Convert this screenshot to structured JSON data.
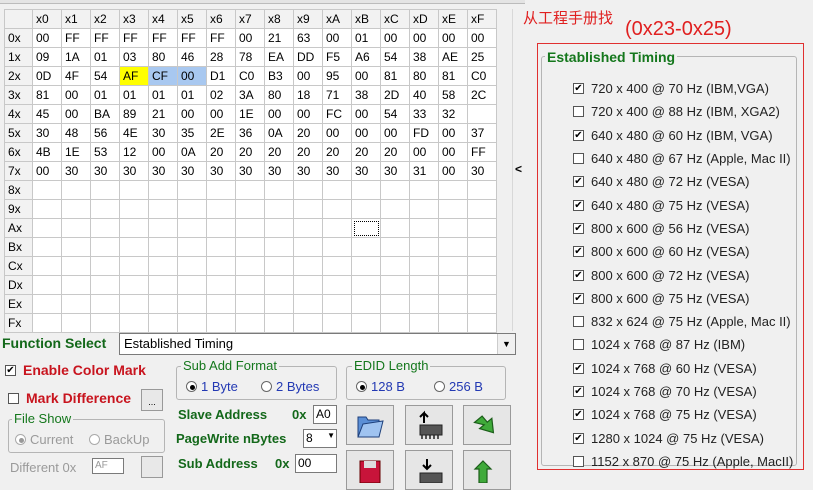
{
  "grid": {
    "col_headers": [
      "x0",
      "x1",
      "x2",
      "x3",
      "x4",
      "x5",
      "x6",
      "x7",
      "x8",
      "x9",
      "xA",
      "xB",
      "xC",
      "xD",
      "xE",
      "xF"
    ],
    "rows": [
      {
        "label": "0x",
        "cells": [
          "00",
          "FF",
          "FF",
          "FF",
          "FF",
          "FF",
          "FF",
          "00",
          "21",
          "63",
          "00",
          "01",
          "00",
          "00",
          "00",
          "00"
        ]
      },
      {
        "label": "1x",
        "cells": [
          "09",
          "1A",
          "01",
          "03",
          "80",
          "46",
          "28",
          "78",
          "EA",
          "DD",
          "F5",
          "A6",
          "54",
          "38",
          "AE",
          "25"
        ]
      },
      {
        "label": "2x",
        "cells": [
          "0D",
          "4F",
          "54",
          "AF",
          "CF",
          "00",
          "D1",
          "C0",
          "B3",
          "00",
          "95",
          "00",
          "81",
          "80",
          "81",
          "C0"
        ]
      },
      {
        "label": "3x",
        "cells": [
          "81",
          "00",
          "01",
          "01",
          "01",
          "01",
          "02",
          "3A",
          "80",
          "18",
          "71",
          "38",
          "2D",
          "40",
          "58",
          "2C"
        ]
      },
      {
        "label": "4x",
        "cells": [
          "45",
          "00",
          "BA",
          "89",
          "21",
          "00",
          "00",
          "1E",
          "00",
          "00",
          "FC",
          "00",
          "54",
          "33",
          "32",
          ""
        ]
      },
      {
        "label": "5x",
        "cells": [
          "30",
          "48",
          "56",
          "4E",
          "30",
          "35",
          "2E",
          "36",
          "0A",
          "20",
          "00",
          "00",
          "00",
          "FD",
          "00",
          "37"
        ]
      },
      {
        "label": "6x",
        "cells": [
          "4B",
          "1E",
          "53",
          "12",
          "00",
          "0A",
          "20",
          "20",
          "20",
          "20",
          "20",
          "20",
          "20",
          "00",
          "00",
          "FF"
        ]
      },
      {
        "label": "7x",
        "cells": [
          "00",
          "30",
          "30",
          "30",
          "30",
          "30",
          "30",
          "30",
          "30",
          "30",
          "30",
          "30",
          "30",
          "31",
          "00",
          "30"
        ]
      },
      {
        "label": "8x",
        "cells": [
          "",
          "",
          "",
          "",
          "",
          "",
          "",
          "",
          "",
          "",
          "",
          "",
          "",
          "",
          "",
          ""
        ]
      },
      {
        "label": "9x",
        "cells": [
          "",
          "",
          "",
          "",
          "",
          "",
          "",
          "",
          "",
          "",
          "",
          "",
          "",
          "",
          "",
          ""
        ]
      },
      {
        "label": "Ax",
        "cells": [
          "",
          "",
          "",
          "",
          "",
          "",
          "",
          "",
          "",
          "",
          "",
          "",
          "",
          "",
          "",
          ""
        ]
      },
      {
        "label": "Bx",
        "cells": [
          "",
          "",
          "",
          "",
          "",
          "",
          "",
          "",
          "",
          "",
          "",
          "",
          "",
          "",
          "",
          ""
        ]
      },
      {
        "label": "Cx",
        "cells": [
          "",
          "",
          "",
          "",
          "",
          "",
          "",
          "",
          "",
          "",
          "",
          "",
          "",
          "",
          "",
          ""
        ]
      },
      {
        "label": "Dx",
        "cells": [
          "",
          "",
          "",
          "",
          "",
          "",
          "",
          "",
          "",
          "",
          "",
          "",
          "",
          "",
          "",
          ""
        ]
      },
      {
        "label": "Ex",
        "cells": [
          "",
          "",
          "",
          "",
          "",
          "",
          "",
          "",
          "",
          "",
          "",
          "",
          "",
          "",
          "",
          ""
        ]
      },
      {
        "label": "Fx",
        "cells": [
          "",
          "",
          "",
          "",
          "",
          "",
          "",
          "",
          "",
          "",
          "",
          "",
          "",
          "",
          "",
          ""
        ]
      }
    ],
    "highlight_colors": {
      "yellow": "#ffff00",
      "blue": "#a8c8f0"
    }
  },
  "scroll_arrow": "<",
  "annotation": {
    "chinese_note": "从工程手册找",
    "range_note": "(0x23-0x25)",
    "color": "#e02020"
  },
  "established_timing": {
    "title": "Established Timing",
    "items": [
      {
        "label": "720 x 400 @ 70 Hz  (IBM,VGA)",
        "checked": true
      },
      {
        "label": "720 x 400 @ 88 Hz  (IBM, XGA2)",
        "checked": false
      },
      {
        "label": "640 x 480 @ 60 Hz  (IBM, VGA)",
        "checked": true
      },
      {
        "label": "640 x 480 @ 67 Hz  (Apple, Mac II)",
        "checked": false
      },
      {
        "label": "640 x 480 @ 72 Hz  (VESA)",
        "checked": true
      },
      {
        "label": "640 x 480 @ 75 Hz  (VESA)",
        "checked": true
      },
      {
        "label": "800 x 600 @ 56 Hz  (VESA)",
        "checked": true
      },
      {
        "label": "800 x 600 @ 60 Hz  (VESA)",
        "checked": true
      },
      {
        "label": "800 x 600 @ 72 Hz  (VESA)",
        "checked": true
      },
      {
        "label": "800 x 600 @ 75 Hz  (VESA)",
        "checked": true
      },
      {
        "label": "832 x 624 @ 75 Hz  (Apple, Mac II)",
        "checked": false
      },
      {
        "label": "1024 x 768 @ 87 Hz (IBM)",
        "checked": false
      },
      {
        "label": "1024 x 768 @ 60 Hz  (VESA)",
        "checked": true
      },
      {
        "label": "1024 x 768 @ 70 Hz  (VESA)",
        "checked": true
      },
      {
        "label": "1024 x 768 @ 75 Hz  (VESA)",
        "checked": true
      },
      {
        "label": "1280 x 1024 @ 75 Hz  (VESA)",
        "checked": true
      },
      {
        "label": "1152 x 870 @ 75 Hz (Apple, MacII)",
        "checked": false
      }
    ]
  },
  "function_select": {
    "label": "Function Select",
    "value": "Established Timing",
    "drop_icon": "▼"
  },
  "enable_color_mark": {
    "label": "Enable Color Mark",
    "checked": true,
    "check": "✔"
  },
  "mark_difference": {
    "label": "Mark Difference",
    "checked": false,
    "button_icon": "..."
  },
  "file_show": {
    "title": "File Show",
    "current": "Current",
    "backup": "BackUp"
  },
  "different": {
    "label": "Different  0x",
    "value": "AF"
  },
  "sub_add_format": {
    "title": "Sub Add Format",
    "one_byte": "1 Byte",
    "two_bytes": "2 Bytes"
  },
  "edid_length": {
    "title": "EDID Length",
    "b128": "128 B",
    "b256": "256 B"
  },
  "slave_address": {
    "label": "Slave Address",
    "prefix": "0x",
    "value": "A0"
  },
  "page_write": {
    "label": "PageWrite nBytes",
    "value": "8",
    "drop_icon": "▼"
  },
  "sub_address": {
    "label": "Sub Address",
    "prefix": "0x",
    "value": "00"
  },
  "check_mark": "✔"
}
